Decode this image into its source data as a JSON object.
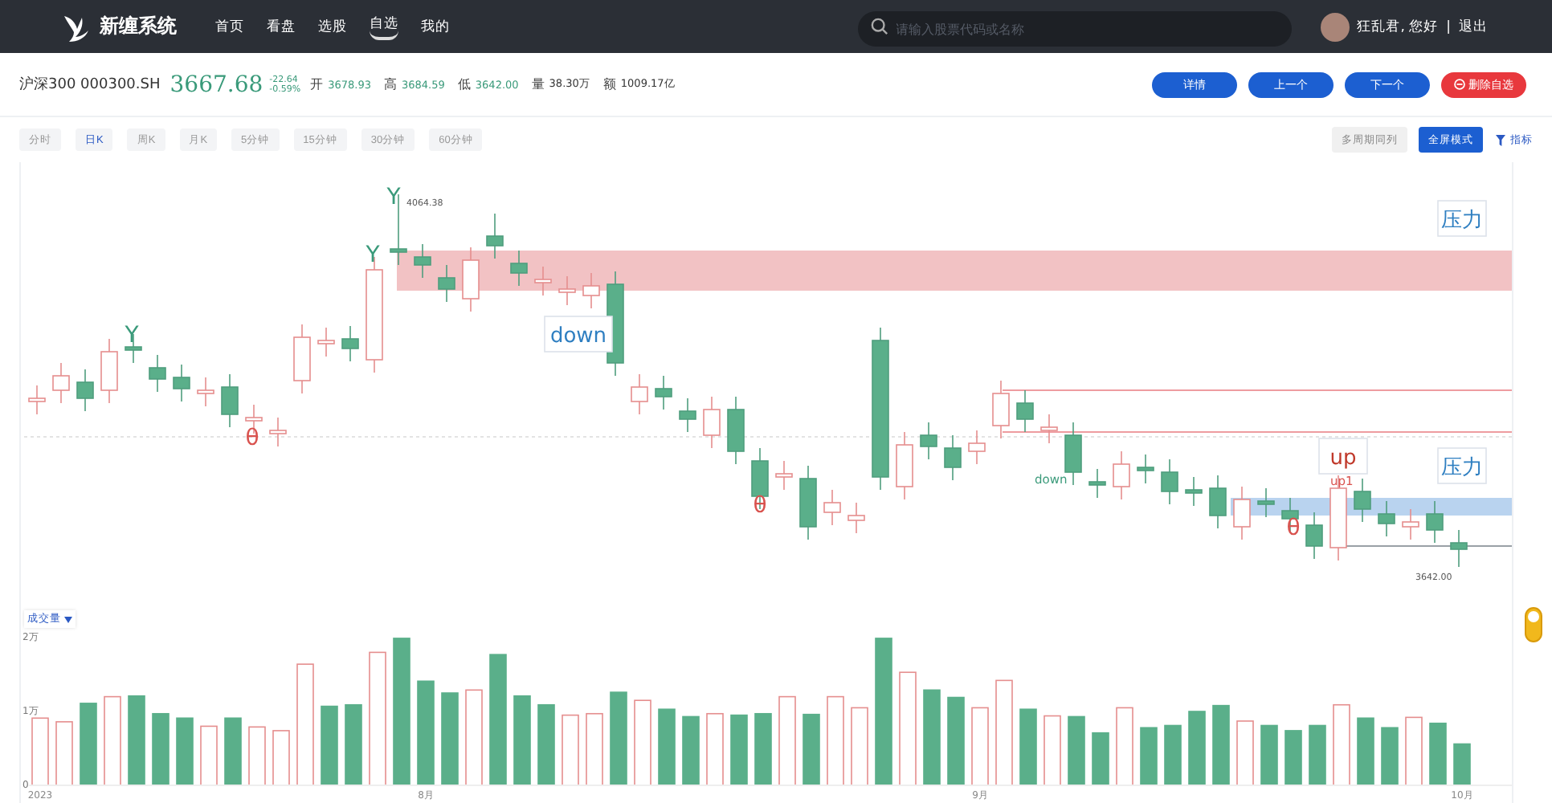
{
  "nav": {
    "brand": "新缠系统",
    "items": [
      {
        "label": "首页",
        "selected": false
      },
      {
        "label": "看盘",
        "selected": false
      },
      {
        "label": "选股",
        "selected": false
      },
      {
        "label": "自选",
        "selected": true
      },
      {
        "label": "我的",
        "selected": false
      }
    ],
    "search": {
      "placeholder": "请输入股票代码或名称"
    },
    "user": {
      "greeting": "狂乱君, 您好",
      "separator": "|",
      "logout": "退出"
    }
  },
  "quote": {
    "name": "沪深300 000300.SH",
    "price": "3667.68",
    "change": "-22.64",
    "change_pct": "-0.59%",
    "stats": [
      {
        "label": "开",
        "value": "3678.93",
        "kind": "price"
      },
      {
        "label": "高",
        "value": "3684.59",
        "kind": "price"
      },
      {
        "label": "低",
        "value": "3642.00",
        "kind": "price"
      },
      {
        "label": "量",
        "value": "38.30万",
        "kind": "plain"
      },
      {
        "label": "额",
        "value": "1009.17亿",
        "kind": "plain"
      }
    ],
    "buttons": [
      {
        "label": "详情",
        "kind": "primary"
      },
      {
        "label": "上一个",
        "kind": "primary"
      },
      {
        "label": "下一个",
        "kind": "primary"
      },
      {
        "label": "删除自选",
        "kind": "danger"
      }
    ]
  },
  "periods": [
    {
      "label": "分时",
      "selected": false
    },
    {
      "label": "日K",
      "selected": true
    },
    {
      "label": "周K",
      "selected": false
    },
    {
      "label": "月K",
      "selected": false
    },
    {
      "label": "5分钟",
      "selected": false
    },
    {
      "label": "15分钟",
      "selected": false
    },
    {
      "label": "30分钟",
      "selected": false
    },
    {
      "label": "60分钟",
      "selected": false
    }
  ],
  "view_buttons": [
    {
      "label": "多周期同列",
      "selected": false
    },
    {
      "label": "全屏模式",
      "selected": true
    }
  ],
  "indicator_link": "指标",
  "kline": {
    "annotations": [
      {
        "text": "Y",
        "kind": "signal",
        "color": "#3a9a7a"
      },
      {
        "text": "θ",
        "kind": "signal",
        "color": "#d9534f"
      },
      {
        "text": "Y",
        "kind": "signal",
        "color": "#3a9a7a"
      },
      {
        "text": "Y",
        "kind": "signal",
        "color": "#3a9a7a"
      },
      {
        "text": "4064.38",
        "kind": "price",
        "color": "#555555"
      },
      {
        "text": "down",
        "kind": "callout",
        "color": "#2f7fc1"
      },
      {
        "text": "压力",
        "kind": "callout",
        "color": "#2f7fc1"
      },
      {
        "text": "θ",
        "kind": "signal",
        "color": "#d9534f"
      },
      {
        "text": "down",
        "kind": "tag",
        "color": "#3a9a7a"
      },
      {
        "text": "up",
        "kind": "callout",
        "color": "#c0392b"
      },
      {
        "text": "up1",
        "kind": "tag",
        "color": "#d9534f"
      },
      {
        "text": "θ",
        "kind": "signal",
        "color": "#d9534f"
      },
      {
        "text": "压力",
        "kind": "callout",
        "color": "#2f7fc1"
      },
      {
        "text": "3642.00",
        "kind": "price",
        "color": "#555555"
      }
    ]
  },
  "volume": {
    "indicator": "成交量",
    "chart_data": {
      "type": "bar",
      "stacked": true,
      "ylim": [
        0,
        2
      ],
      "categories": [
        "2023",
        null,
        null,
        null,
        null,
        null,
        null,
        null,
        null,
        null,
        null,
        null,
        null,
        null,
        null,
        null,
        "8月",
        null,
        null,
        null,
        null,
        null,
        null,
        null,
        null,
        null,
        null,
        null,
        null,
        null,
        null,
        null,
        null,
        null,
        null,
        null,
        null,
        null,
        null,
        "9月",
        null,
        null,
        null,
        null,
        null,
        null,
        null,
        null,
        null,
        null,
        null,
        null,
        null,
        null,
        null,
        null,
        null,
        null,
        null,
        "10月"
      ],
      "yticks": [
        {
          "value": 0,
          "label": "0"
        },
        {
          "value": 1,
          "label": "1万"
        },
        {
          "value": 2,
          "label": "2万"
        }
      ],
      "series": [
        {
          "color": "#e58e8e",
          "values": [
            0.91,
            0.86,
            null,
            1.2,
            null,
            null,
            null,
            0.8,
            null,
            0.79,
            0.74,
            1.64,
            null,
            null,
            1.8,
            null,
            null,
            null,
            1.29,
            null,
            null,
            null,
            0.95,
            0.97,
            null,
            1.15,
            null,
            null,
            0.97,
            null,
            null,
            1.2,
            null,
            1.2,
            1.05,
            null,
            1.53,
            null,
            null,
            1.05,
            1.42,
            null,
            0.94,
            null,
            null,
            1.05,
            null,
            null,
            null,
            null,
            0.87,
            null,
            null,
            null,
            1.09,
            null,
            null,
            0.92,
            null,
            null
          ]
        },
        {
          "color": "#5aaf8a",
          "values": [
            null,
            null,
            1.11,
            null,
            1.21,
            0.97,
            0.91,
            null,
            0.91,
            null,
            null,
            null,
            1.07,
            1.09,
            null,
            1.99,
            1.41,
            1.25,
            null,
            1.77,
            1.21,
            1.09,
            null,
            null,
            1.26,
            null,
            1.03,
            0.93,
            null,
            0.95,
            0.97,
            null,
            0.96,
            null,
            null,
            1.99,
            null,
            1.29,
            1.19,
            null,
            null,
            1.03,
            null,
            0.93,
            0.71,
            null,
            0.78,
            0.81,
            1.0,
            1.08,
            null,
            0.81,
            0.74,
            0.81,
            null,
            0.91,
            0.78,
            null,
            0.84,
            0.56
          ]
        }
      ]
    }
  }
}
